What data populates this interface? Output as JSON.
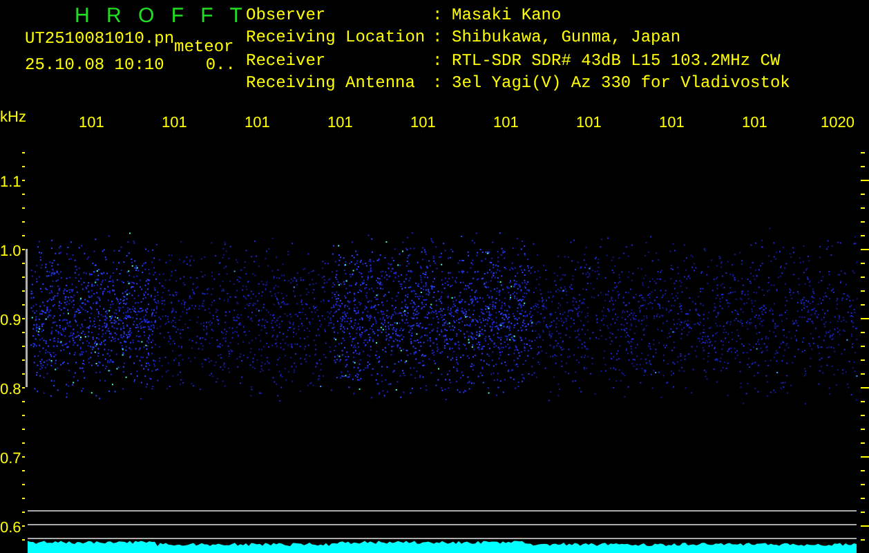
{
  "header": {
    "app_title": "H R O F F T",
    "file_name": "UT2510081010.pn",
    "mode": "meteor",
    "date_time": "25.10.08 10:10",
    "counter": "0.."
  },
  "station_info": [
    {
      "label": "Observer",
      "separator": ":",
      "value": "Masaki Kano"
    },
    {
      "label": "Receiving Location",
      "separator": ":",
      "value": "Shibukawa, Gunma, Japan"
    },
    {
      "label": "Receiver",
      "separator": ":",
      "value": "RTL-SDR SDR# 43dB L15 103.2MHz CW"
    },
    {
      "label": "Receiving Antenna",
      "separator": ":",
      "value": "3el Yagi(V) Az 330 for Vladivostok"
    }
  ],
  "axes": {
    "y_unit": "kHz",
    "x_ticks": [
      "101",
      "101",
      "101",
      "101",
      "101",
      "101",
      "101",
      "101",
      "101",
      "1020"
    ],
    "y_ticks": [
      "1.1",
      "1.0",
      "0.9",
      "0.8",
      "0.7",
      "0.6"
    ]
  }
}
